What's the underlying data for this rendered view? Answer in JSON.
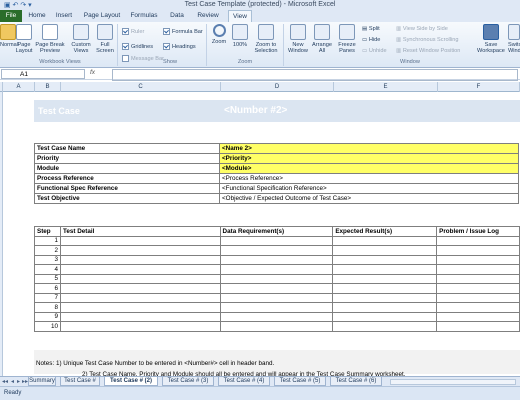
{
  "window": {
    "title": "Test Case Template (protected) - Microsoft Excel"
  },
  "ribbon_tabs": [
    "File",
    "Home",
    "Insert",
    "Page Layout",
    "Formulas",
    "Data",
    "Review",
    "View"
  ],
  "active_tab": "View",
  "ribbon": {
    "workbook_views": {
      "label": "Workbook Views",
      "buttons": [
        "Normal",
        "Page Layout",
        "Page Break Preview",
        "Custom Views",
        "Full Screen"
      ]
    },
    "show": {
      "label": "Show",
      "ruler": "Ruler",
      "gridlines": "Gridlines",
      "message_bar": "Message Bar",
      "formula_bar": "Formula Bar",
      "headings": "Headings"
    },
    "zoom": {
      "label": "Zoom",
      "buttons": [
        "Zoom",
        "100%",
        "Zoom to Selection"
      ]
    },
    "window": {
      "label": "Window",
      "buttons": [
        "New Window",
        "Arrange All",
        "Freeze Panes"
      ],
      "split": "Split",
      "hide": "Hide",
      "unhide": "Unhide",
      "view_side_by_side": "View Side by Side",
      "sync_scrolling": "Synchronous Scrolling",
      "reset_position": "Reset Window Position",
      "save_workspace": "Save Workspace",
      "switch_windows": "Switch Windows"
    }
  },
  "name_box": "A1",
  "fx": "fx",
  "columns": [
    "A",
    "B",
    "C",
    "D",
    "E",
    "F"
  ],
  "header_band": {
    "left": "Test Case",
    "right": "<Number #2>"
  },
  "info_rows": [
    {
      "label": "Test Case Name",
      "value": "<Name 2>"
    },
    {
      "label": "Priority",
      "value": "<Priority>"
    },
    {
      "label": "Module",
      "value": "<Module>"
    },
    {
      "label": "Process Reference",
      "value": "<Process Reference>"
    },
    {
      "label": "Functional Spec Reference",
      "value": "<Functional Specification Reference>"
    },
    {
      "label": "Test Objective",
      "value": "<Objective / Expected Outcome of Test Case>"
    }
  ],
  "steps_table": {
    "headers": [
      "Step",
      "Test Detail",
      "Data Requirement(s)",
      "Expected Result(s)",
      "Problem / Issue Log"
    ],
    "steps": [
      "1",
      "2",
      "3",
      "4",
      "5",
      "6",
      "7",
      "8",
      "9",
      "10"
    ]
  },
  "notes": {
    "line1": "Notes:    1) Unique Test Case Number to be entered in <Number#> cell in header band.",
    "line2": "2) Test Case Name, Priority and Module should all be entered and will appear in the Test Case Summary worksheet."
  },
  "sheet_tabs": [
    "Summary",
    "Test Case #",
    "Test Case # (2)",
    "Test Case # (3)",
    "Test Case # (4)",
    "Test Case # (5)",
    "Test Case # (6)"
  ],
  "active_sheet": "Test Case # (2)",
  "status": "Ready"
}
